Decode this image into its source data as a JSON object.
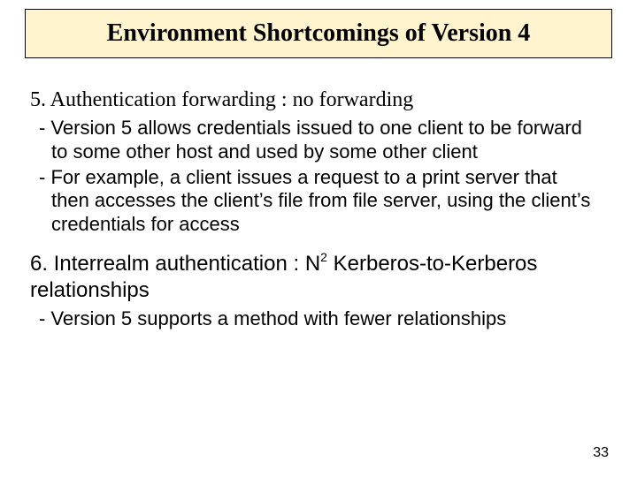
{
  "title": "Environment Shortcomings of Version 4",
  "point5": {
    "heading": "5. Authentication forwarding : no forwarding",
    "sub1": "- Version 5 allows credentials issued to one client to be forward to some other host and used by some other client",
    "sub2": "- For example, a client issues a request to a print server that then accesses the client’s file from file server, using the client’s credentials for access"
  },
  "point6": {
    "heading_pre": "6. Interrealm authentication : N",
    "heading_exp": "2",
    "heading_post": " Kerberos-to-Kerberos relationships",
    "sub1": "- Version 5 supports a method with fewer relationships"
  },
  "page_number": "33"
}
